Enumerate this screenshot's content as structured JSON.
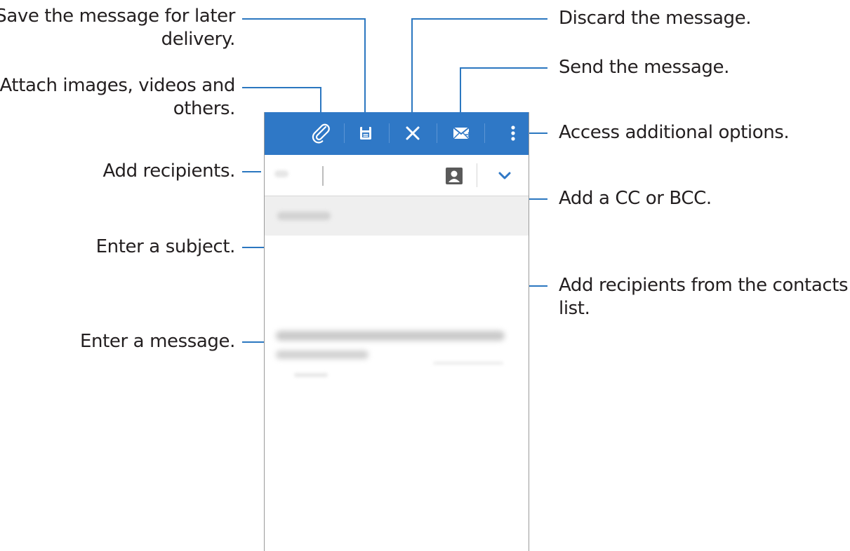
{
  "callouts": {
    "save": [
      "Save the message for later",
      "delivery."
    ],
    "attach": [
      "Attach images, videos and",
      "others."
    ],
    "add_recipients": "Add recipients.",
    "subject": "Enter a subject.",
    "message": "Enter a message.",
    "discard": "Discard the message.",
    "send": "Send the message.",
    "more_options": "Access additional options.",
    "cc_bcc": "Add a CC or BCC.",
    "contacts": [
      "Add recipients from the contacts",
      "list."
    ]
  },
  "icons": {
    "attach": "paperclip-icon",
    "save": "save-draft-icon",
    "discard": "close-icon",
    "send": "send-icon",
    "more": "more-vertical-icon",
    "contacts": "contact-icon",
    "cc_bcc": "chevron-down-icon"
  },
  "colors": {
    "action_bar": "#2f78c6",
    "leader_line": "#2b77c0",
    "text": "#231f20",
    "subject_row": "#efefef"
  }
}
